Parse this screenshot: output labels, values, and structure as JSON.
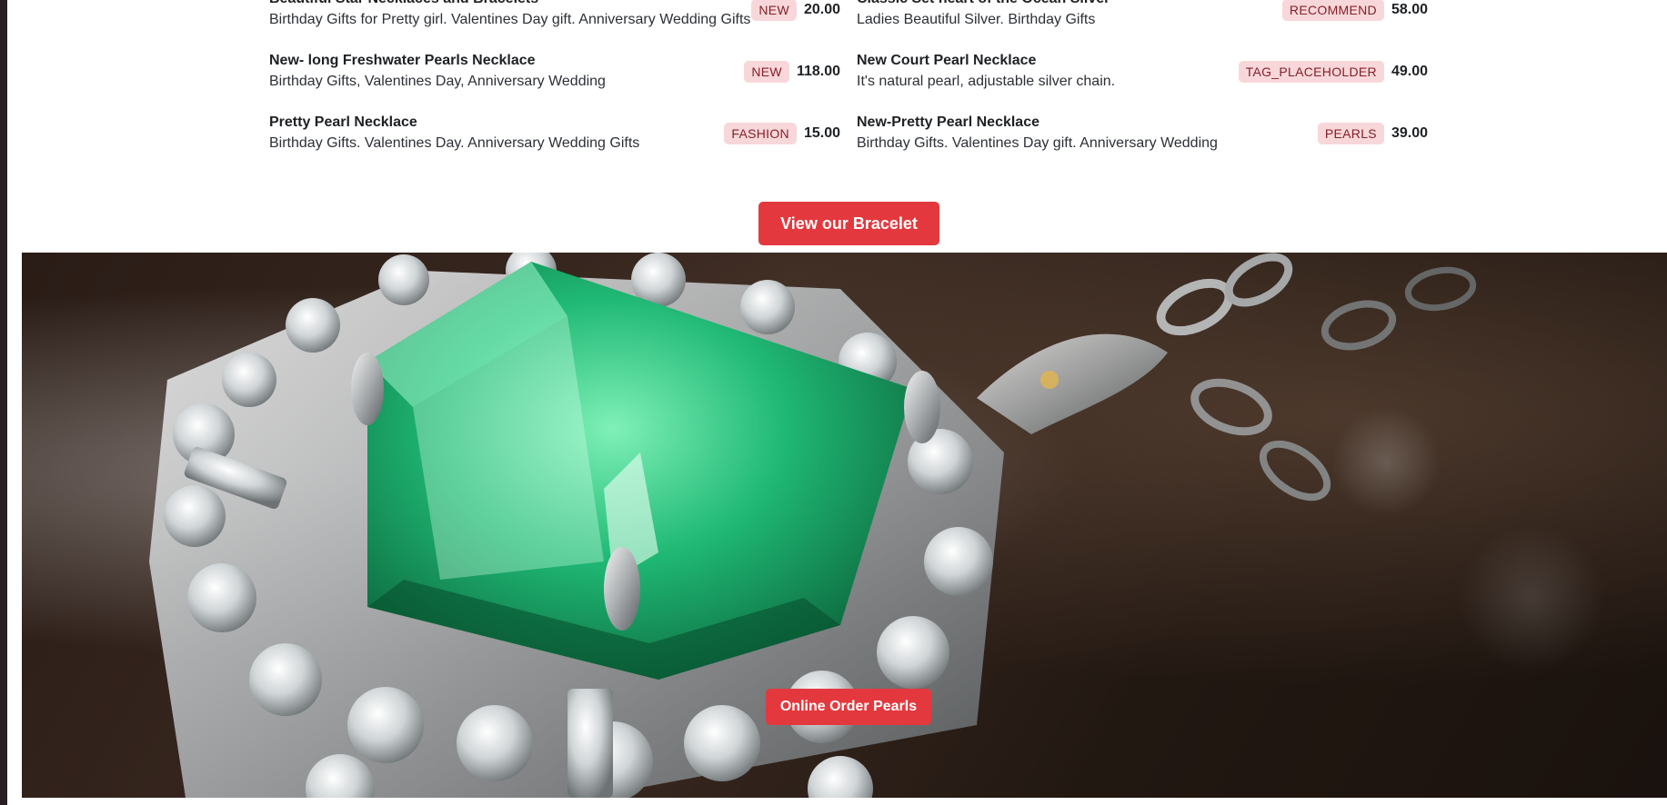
{
  "menu": {
    "items": [
      {
        "name": "Beautiful Star Necklaces and Bracelets",
        "desc": "Birthday Gifts for Pretty girl. Valentines Day gift. Anniversary Wedding Gifts",
        "tag": "NEW",
        "price": "20.00"
      },
      {
        "name": "Classic Set heart of the Ocean Silver",
        "desc": "Ladies Beautiful Silver. Birthday Gifts",
        "tag": "RECOMMEND",
        "price": "58.00"
      },
      {
        "name": "New- long Freshwater Pearls Necklace",
        "desc": "Birthday Gifts, Valentines Day, Anniversary Wedding",
        "tag": "NEW",
        "price": "118.00"
      },
      {
        "name": "New Court Pearl Necklace",
        "desc": "It's natural pearl, adjustable silver chain.",
        "tag": "TAG_PLACEHOLDER",
        "price": "49.00"
      },
      {
        "name": "Pretty Pearl Necklace",
        "desc": "Birthday Gifts. Valentines Day. Anniversary Wedding Gifts",
        "tag": "FASHION",
        "price": "15.00"
      },
      {
        "name": "New-Pretty Pearl Necklace",
        "desc": "Birthday Gifts. Valentines Day gift. Anniversary Wedding",
        "tag": "PEARLS",
        "price": "39.00"
      }
    ]
  },
  "buttons": {
    "view_bracelet": "View our Bracelet",
    "online_order": "Online Order Pearls"
  },
  "hero": {
    "image": "emerald-diamond-pendant-photo"
  },
  "colors": {
    "accent": "#e3393e",
    "tag_bg": "#f8d7da",
    "tag_text": "#842029",
    "emerald": "#1fb874"
  }
}
